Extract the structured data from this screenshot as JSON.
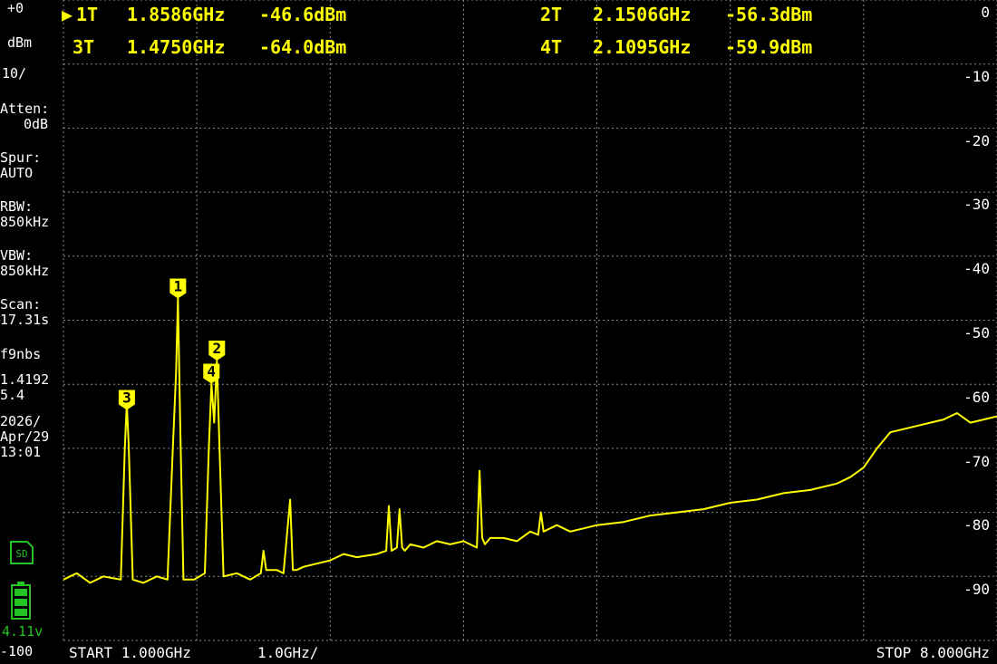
{
  "sidebar": {
    "ref_level": "+0",
    "ref_unit": "dBm",
    "scale": "10/",
    "atten_label": "Atten:",
    "atten_value": "0dB",
    "spur_label": "Spur:",
    "spur_value": "AUTO",
    "rbw_label": "RBW:",
    "rbw_value": "850kHz",
    "vbw_label": "VBW:",
    "vbw_value": "850kHz",
    "scan_label": "Scan:",
    "scan_value": "17.31s",
    "fw_label": "f9nbs",
    "fw_value1": "1.4192",
    "fw_value2": "5.4",
    "date_year": "2026/",
    "date_day": "Apr/29",
    "time": "13:01",
    "sd_label": "SD",
    "battery_voltage": "4.11v",
    "bottom_level": "-100"
  },
  "markers": [
    {
      "id": "1T",
      "freq": "1.8586GHz",
      "level": "-46.6dBm",
      "active": true
    },
    {
      "id": "2T",
      "freq": "2.1506GHz",
      "level": "-56.3dBm",
      "active": false
    },
    {
      "id": "3T",
      "freq": "1.4750GHz",
      "level": "-64.0dBm",
      "active": false
    },
    {
      "id": "4T",
      "freq": "2.1095GHz",
      "level": "-59.9dBm",
      "active": false
    }
  ],
  "footer": {
    "start": "START 1.000GHz",
    "div": "1.0GHz/",
    "stop": "STOP 8.000GHz"
  },
  "chart_data": {
    "type": "line",
    "xlabel": "",
    "ylabel": "",
    "xlim": [
      1.0,
      8.0
    ],
    "ylim": [
      -100,
      0
    ],
    "y_ticks": [
      "0",
      "-10",
      "-20",
      "-30",
      "-40",
      "-50",
      "-60",
      "-70",
      "-80",
      "-90"
    ],
    "grid": true,
    "trace_color": "#ffff00",
    "series": [
      {
        "name": "",
        "x": [
          1.0,
          1.1,
          1.2,
          1.3,
          1.43,
          1.46,
          1.475,
          1.49,
          1.52,
          1.6,
          1.7,
          1.78,
          1.82,
          1.845,
          1.8586,
          1.875,
          1.9,
          1.98,
          2.06,
          2.09,
          2.1095,
          2.13,
          2.1506,
          2.17,
          2.2,
          2.3,
          2.4,
          2.48,
          2.5,
          2.52,
          2.6,
          2.65,
          2.7,
          2.72,
          2.75,
          2.8,
          2.9,
          3.0,
          3.1,
          3.2,
          3.35,
          3.42,
          3.44,
          3.46,
          3.5,
          3.52,
          3.54,
          3.56,
          3.6,
          3.7,
          3.8,
          3.9,
          4.0,
          4.1,
          4.12,
          4.14,
          4.16,
          4.2,
          4.3,
          4.4,
          4.5,
          4.56,
          4.58,
          4.6,
          4.7,
          4.8,
          4.9,
          5.0,
          5.2,
          5.4,
          5.6,
          5.8,
          6.0,
          6.2,
          6.4,
          6.6,
          6.8,
          6.9,
          7.0,
          7.1,
          7.2,
          7.3,
          7.4,
          7.5,
          7.6,
          7.7,
          7.8,
          7.9,
          8.0
        ],
        "y": [
          -90.5,
          -89.5,
          -91,
          -90,
          -90.5,
          -70,
          -63,
          -70,
          -90.5,
          -91,
          -90,
          -90.5,
          -70,
          -58,
          -46.6,
          -66,
          -90.5,
          -90.5,
          -89.5,
          -70,
          -59.9,
          -66,
          -56.3,
          -70,
          -90,
          -89.5,
          -90.5,
          -89.5,
          -86,
          -89,
          -89,
          -89.5,
          -78,
          -89,
          -89,
          -88.5,
          -88,
          -87.5,
          -86.5,
          -87,
          -86.5,
          -86,
          -79,
          -86,
          -85.5,
          -79.5,
          -85.5,
          -86,
          -85,
          -85.5,
          -84.5,
          -85,
          -84.5,
          -85.5,
          -73.5,
          -84,
          -85,
          -84,
          -84,
          -84.5,
          -83,
          -83.5,
          -80,
          -83,
          -82,
          -83,
          -82.5,
          -82,
          -81.5,
          -80.5,
          -80,
          -79.5,
          -78.5,
          -78,
          -77,
          -76.5,
          -75.5,
          -74.5,
          -73,
          -70,
          -67.5,
          -67,
          -66.5,
          -66,
          -65.5,
          -64.5,
          -66,
          -65.5,
          -65
        ]
      }
    ]
  }
}
